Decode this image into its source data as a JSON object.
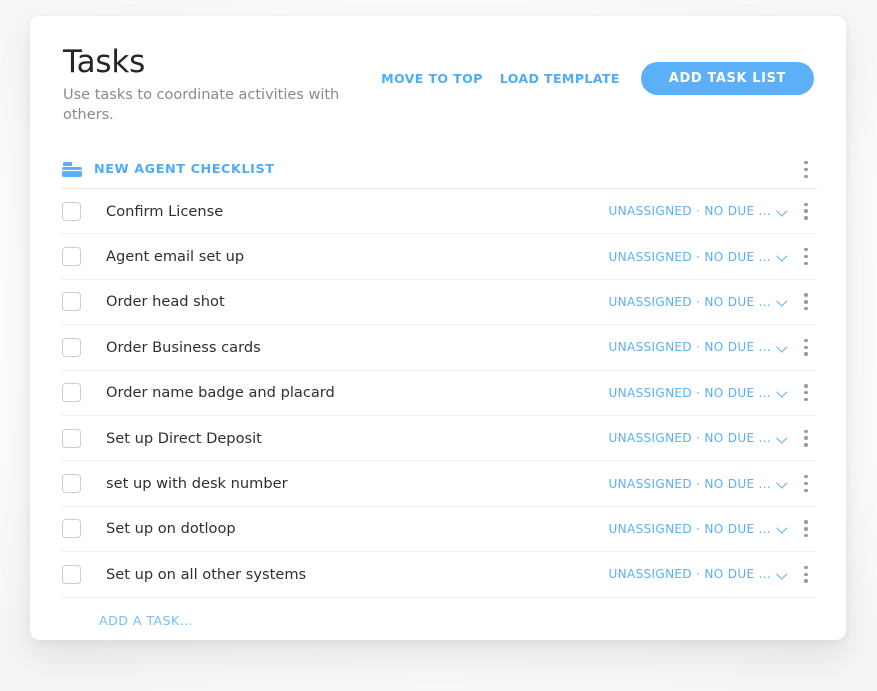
{
  "header": {
    "title": "Tasks",
    "subtitle": "Use tasks to coordinate activities with others.",
    "actions": {
      "move_to_top": "MOVE TO TOP",
      "load_template": "LOAD TEMPLATE",
      "add_task_list": "ADD TASK LIST"
    }
  },
  "colors": {
    "accent_blue": "#5bb0f7",
    "link_blue": "#4facf7",
    "text_dark": "#2f2f2f",
    "subtitle_gray": "#8a8a8a",
    "divider": "#efefef",
    "card_bg": "#ffffff"
  },
  "task_list": {
    "name": "NEW AGENT CHECKLIST",
    "folder_icon": "folder-icon",
    "menu_icon": "kebab-menu-icon",
    "tasks": [
      {
        "title": "Confirm License",
        "meta": "UNASSIGNED · NO DUE ...",
        "checked": false
      },
      {
        "title": "Agent email set up",
        "meta": "UNASSIGNED · NO DUE ...",
        "checked": false
      },
      {
        "title": "Order head shot",
        "meta": "UNASSIGNED · NO DUE ...",
        "checked": false
      },
      {
        "title": "Order Business cards",
        "meta": "UNASSIGNED · NO DUE ...",
        "checked": false
      },
      {
        "title": "Order name badge and placard",
        "meta": "UNASSIGNED · NO DUE ...",
        "checked": false
      },
      {
        "title": "Set up Direct Deposit",
        "meta": "UNASSIGNED · NO DUE ...",
        "checked": false
      },
      {
        "title": "set up with desk number",
        "meta": "UNASSIGNED · NO DUE ...",
        "checked": false
      },
      {
        "title": "Set up on dotloop",
        "meta": "UNASSIGNED · NO DUE ...",
        "checked": false
      },
      {
        "title": "Set up on all other systems",
        "meta": "UNASSIGNED · NO DUE ...",
        "checked": false
      }
    ],
    "add_task_label": "ADD A TASK..."
  }
}
